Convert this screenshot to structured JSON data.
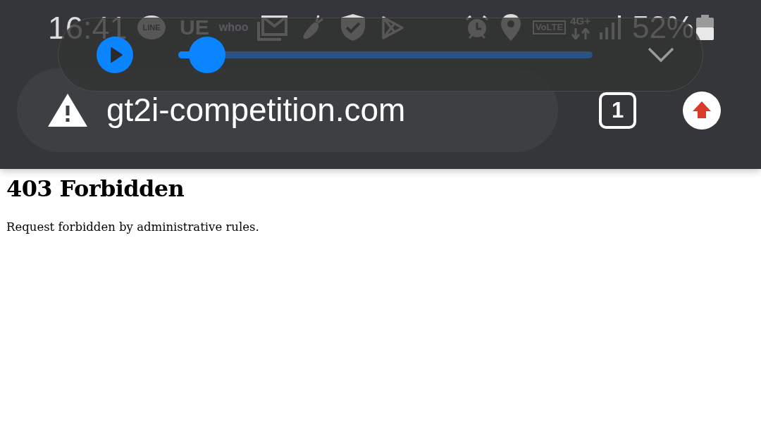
{
  "status_bar": {
    "time": "16:41",
    "line_badge": "LINE",
    "ue_badge": "UE",
    "whoo_logo": "whoo",
    "volte_badge": "VoLTE",
    "network_type": "4G+",
    "battery_percent": "52%"
  },
  "media_player": {
    "playing": false,
    "seek": {
      "level": 0.07
    }
  },
  "browser_toolbar": {
    "secure": false,
    "url": "gt2i-competition.com",
    "tab_count": "1"
  },
  "page": {
    "heading": "403 Forbidden",
    "message": "Request forbidden by administrative rules."
  }
}
